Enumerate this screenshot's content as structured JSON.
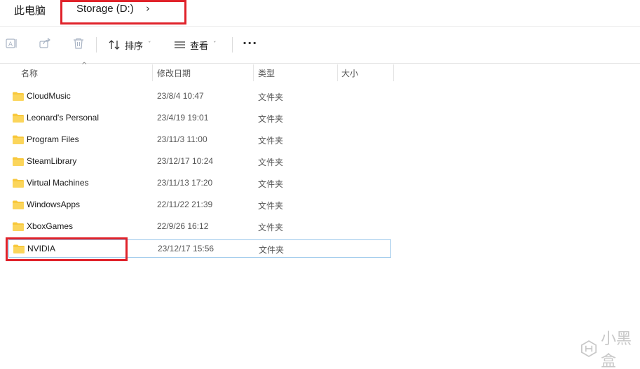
{
  "breadcrumb": {
    "root": "此电脑",
    "current": "Storage (D:)",
    "chevron": "›"
  },
  "toolbar": {
    "sort_label": "排序",
    "view_label": "查看",
    "more_label": "···",
    "caret": "ˇ",
    "icons": [
      "rename-icon",
      "share-icon",
      "delete-icon",
      "sort-icon",
      "view-icon"
    ]
  },
  "columns": {
    "name": "名称",
    "date": "修改日期",
    "type": "类型",
    "size": "大小",
    "sort_arrow": "^"
  },
  "rows": [
    {
      "name": "CloudMusic",
      "date": "23/8/4 10:47",
      "type": "文件夹"
    },
    {
      "name": "Leonard's Personal",
      "date": "23/4/19 19:01",
      "type": "文件夹"
    },
    {
      "name": "Program Files",
      "date": "23/11/3 11:00",
      "type": "文件夹"
    },
    {
      "name": "SteamLibrary",
      "date": "23/12/17 10:24",
      "type": "文件夹"
    },
    {
      "name": "Virtual Machines",
      "date": "23/11/13 17:20",
      "type": "文件夹"
    },
    {
      "name": "WindowsApps",
      "date": "22/11/22 21:39",
      "type": "文件夹"
    },
    {
      "name": "XboxGames",
      "date": "22/9/26 16:12",
      "type": "文件夹"
    },
    {
      "name": "NVIDIA",
      "date": "23/12/17 15:56",
      "type": "文件夹"
    }
  ],
  "watermark": {
    "text": "小黑盒"
  },
  "colors": {
    "highlight": "#e0222a",
    "folder": "#f8c83c",
    "selection_border": "#98c6ea"
  }
}
